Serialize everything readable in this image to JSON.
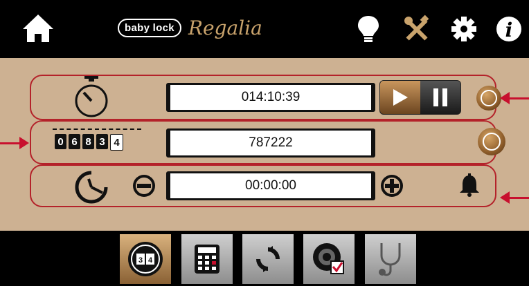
{
  "header": {
    "brand_logo_text": "baby lock",
    "brand_name": "Regalia",
    "icons": [
      "home-icon",
      "lightbulb-icon",
      "tools-icon",
      "gear-icon",
      "info-icon"
    ]
  },
  "stopwatch": {
    "time": "014:10:39",
    "icon": "stopwatch-icon",
    "controls": [
      "play-icon",
      "pause-icon",
      "reset-icon"
    ]
  },
  "counter": {
    "value": "787222",
    "icon_digits": [
      "0",
      "6",
      "8",
      "3",
      "4"
    ],
    "controls": [
      "reset-icon"
    ]
  },
  "timer": {
    "time": "00:00:00",
    "icon": "timer-icon",
    "controls": [
      "minus-icon",
      "plus-icon",
      "bell-icon"
    ]
  },
  "bottom_tabs": [
    {
      "name": "counter-tab",
      "icon": "stitch-counter-icon",
      "active": true
    },
    {
      "name": "calculator-tab",
      "icon": "calculator-icon",
      "active": false
    },
    {
      "name": "sync-tab",
      "icon": "sync-icon",
      "active": false
    },
    {
      "name": "bobbin-check-tab",
      "icon": "bobbin-check-icon",
      "active": false
    },
    {
      "name": "diagnostics-tab",
      "icon": "stethoscope-icon",
      "active": false
    }
  ],
  "colors": {
    "panel": "#cdb192",
    "accent_gold": "#c9a36c",
    "highlight_red": "#c8102e"
  }
}
